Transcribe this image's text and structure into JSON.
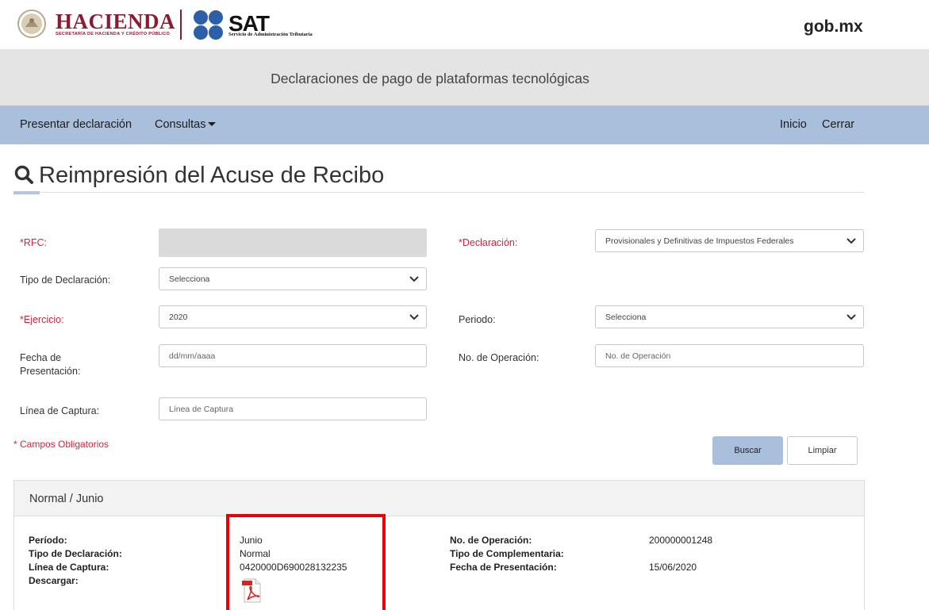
{
  "header": {
    "hacienda_title": "HACIENDA",
    "hacienda_subtitle": "SECRETARÍA DE HACIENDA Y CRÉDITO PÚBLICO",
    "sat_title": "SAT",
    "sat_subtitle": "Servicio de Administración Tributaria",
    "gob_logo": "gob.mx",
    "brand_color": "#8a1c32"
  },
  "app_title": "Declaraciones de pago de plataformas tecnológicas",
  "nav": {
    "presentar": "Presentar declaración",
    "consultas": "Consultas",
    "inicio": "Inicio",
    "cerrar": "Cerrar",
    "bar_color": "#a9bfdc"
  },
  "page": {
    "icon": "search-icon",
    "title": "Reimpresión del Acuse de Recibo"
  },
  "form": {
    "rfc_label": "*RFC:",
    "declaracion_label": "*Declaración:",
    "declaracion_value": "Provisionales y Definitivas de Impuestos Federales",
    "tipo_label": "Tipo de Declaración:",
    "tipo_value": "Selecciona",
    "ejercicio_label": "*Ejercicio:",
    "ejercicio_value": "2020",
    "periodo_label": "Periodo:",
    "periodo_value": "Selecciona",
    "fecha_label_1": "Fecha de",
    "fecha_label_2": "Presentación:",
    "fecha_placeholder": "dd/mm/aaaa",
    "operacion_label": "No. de Operación:",
    "operacion_placeholder": "No. de Operación",
    "linea_label": "Línea de Captura:",
    "linea_placeholder": "Línea de Captura",
    "required_note": "* Campos Obligatorios",
    "buscar": "Buscar",
    "limpiar": "Limpiar"
  },
  "result": {
    "header": "Normal / Junio",
    "periodo_label": "Período:",
    "periodo_value": "Junio",
    "tipo_label": "Tipo de Declaración:",
    "tipo_value": "Normal",
    "linea_label": "Línea de Captura:",
    "linea_value": "0420000D690028132235",
    "descargar_label": "Descargar:",
    "descargar_icon": "pdf-icon",
    "operacion_label": "No. de Operación:",
    "operacion_value": "200000001248",
    "complementaria_label": "Tipo de Complementaria:",
    "fecha_label": "Fecha de Presentación:",
    "fecha_value": "15/06/2020",
    "highlight_color": "#e8000b"
  }
}
